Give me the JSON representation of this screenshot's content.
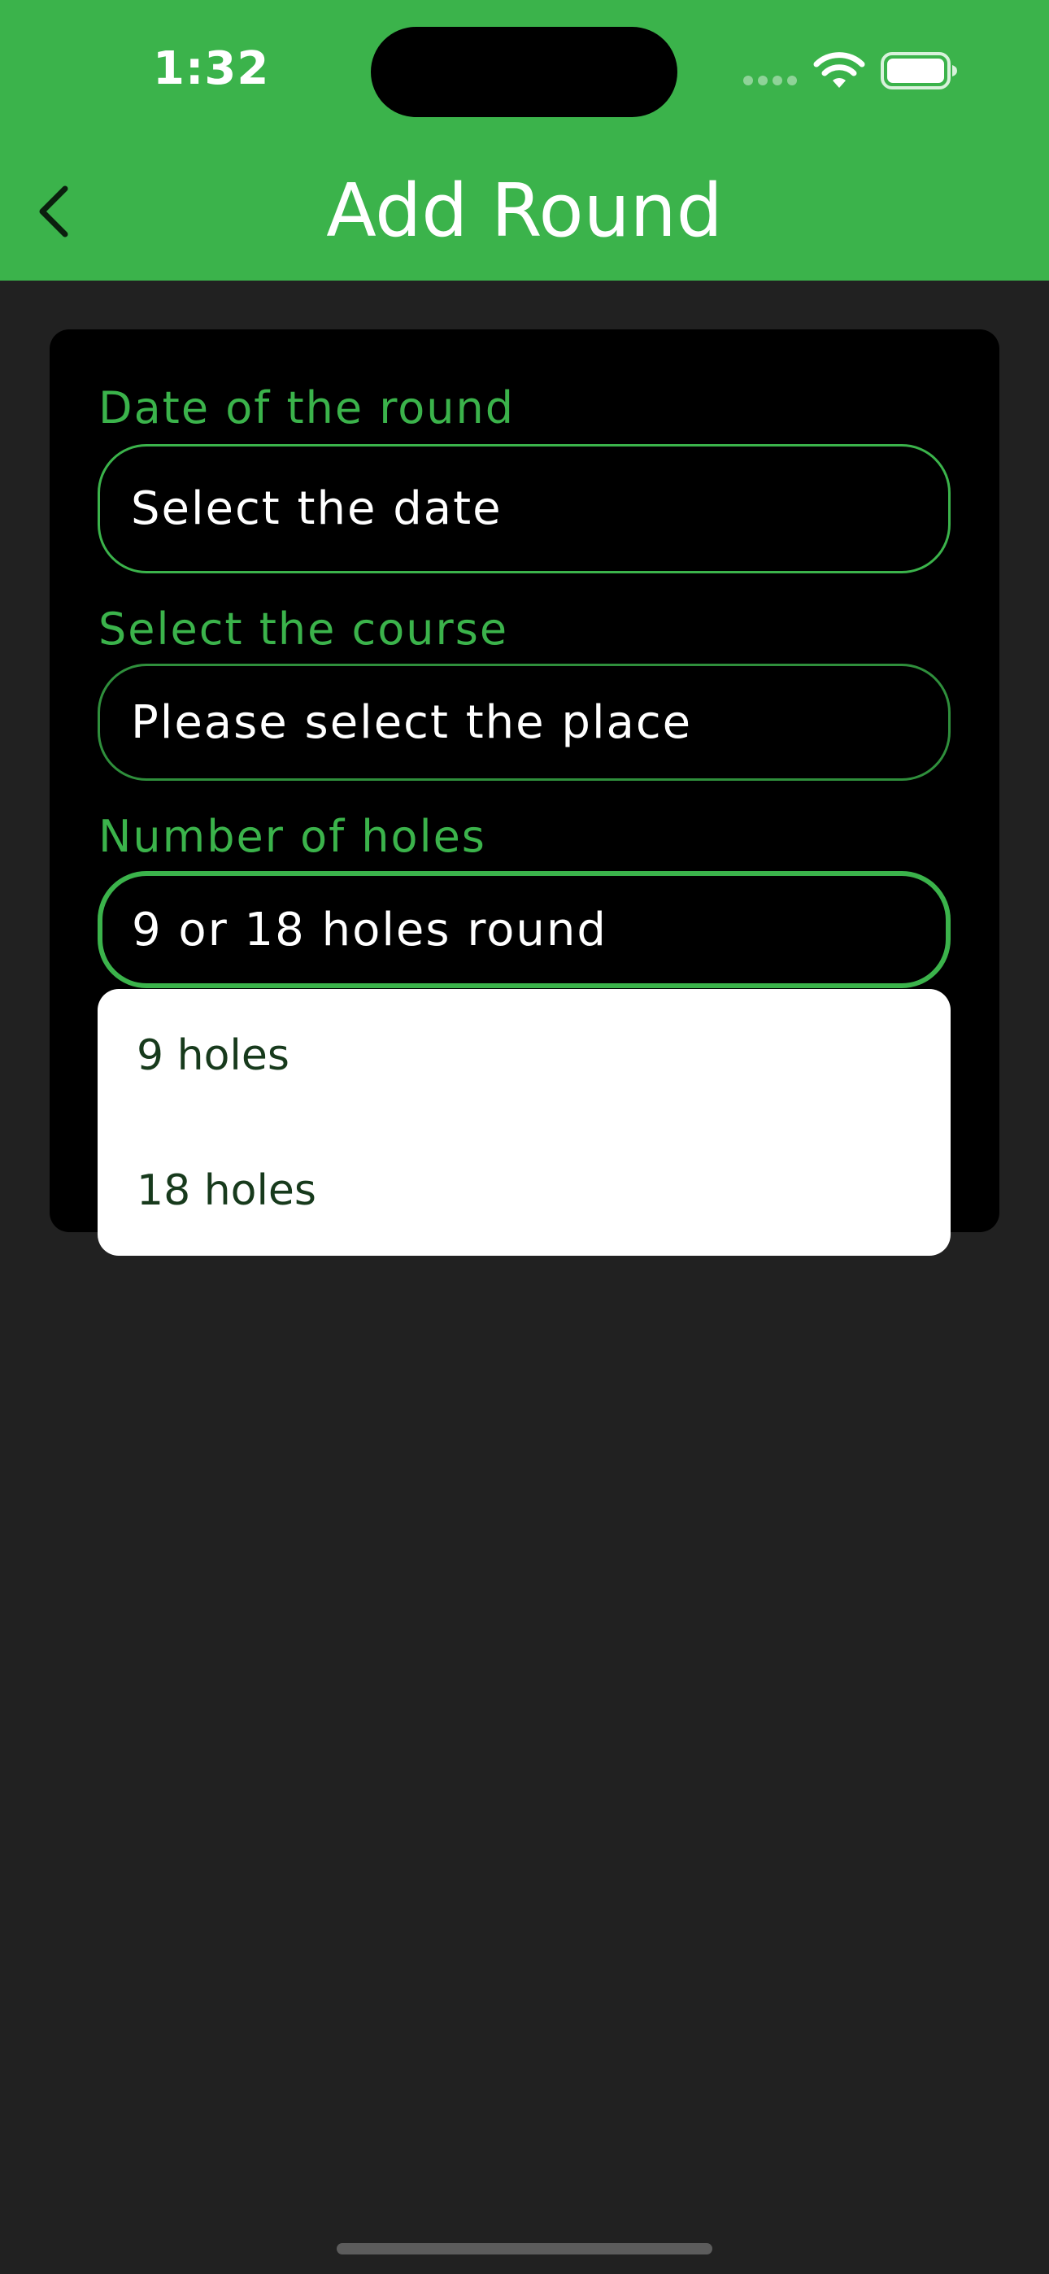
{
  "status_bar": {
    "time": "1:32",
    "icons": [
      "signal-icon",
      "wifi-icon",
      "battery-icon"
    ]
  },
  "nav": {
    "title": "Add Round",
    "back_icon": "chevron-left-icon"
  },
  "form": {
    "date": {
      "label": "Date of the round",
      "placeholder": "Select the date"
    },
    "course": {
      "label": "Select the course",
      "placeholder": "Please select the place"
    },
    "holes": {
      "label": "Number of holes",
      "placeholder": "9 or 18 holes round",
      "options": [
        "9 holes",
        "18 holes"
      ]
    }
  },
  "colors": {
    "accent": "#3bb34b",
    "background": "#212121",
    "card": "#000000",
    "dropdown_text": "#173a1c"
  }
}
